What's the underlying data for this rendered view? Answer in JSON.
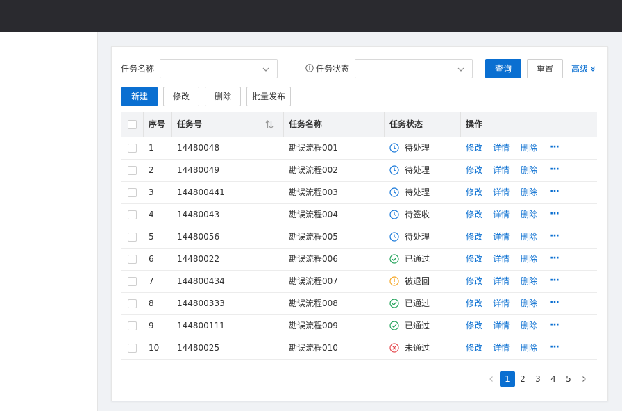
{
  "filters": {
    "task_name_label": "任务名称",
    "task_status_label": "任务状态",
    "task_name_value": "",
    "task_status_value": "",
    "query_label": "查询",
    "reset_label": "重置",
    "advanced_label": "高级"
  },
  "toolbar": {
    "new_label": "新建",
    "edit_label": "修改",
    "delete_label": "删除",
    "batch_publish_label": "批量发布"
  },
  "table": {
    "headers": {
      "index": "序号",
      "task_no": "任务号",
      "task_name": "任务名称",
      "status": "任务状态",
      "actions": "操作"
    },
    "action_labels": {
      "edit": "修改",
      "detail": "详情",
      "delete": "删除",
      "more": "···"
    },
    "rows": [
      {
        "index": "1",
        "task_no": "14480048",
        "task_name": "勘误流程001",
        "status": "待处理",
        "status_type": "pending"
      },
      {
        "index": "2",
        "task_no": "14480049",
        "task_name": "勘误流程002",
        "status": "待处理",
        "status_type": "pending"
      },
      {
        "index": "3",
        "task_no": "144800441",
        "task_name": "勘误流程003",
        "status": "待处理",
        "status_type": "pending"
      },
      {
        "index": "4",
        "task_no": "14480043",
        "task_name": "勘误流程004",
        "status": "待签收",
        "status_type": "pending"
      },
      {
        "index": "5",
        "task_no": "14480056",
        "task_name": "勘误流程005",
        "status": "待处理",
        "status_type": "pending"
      },
      {
        "index": "6",
        "task_no": "14480022",
        "task_name": "勘误流程006",
        "status": "已通过",
        "status_type": "passed"
      },
      {
        "index": "7",
        "task_no": "144800434",
        "task_name": "勘误流程007",
        "status": "被退回",
        "status_type": "returned"
      },
      {
        "index": "8",
        "task_no": "144800333",
        "task_name": "勘误流程008",
        "status": "已通过",
        "status_type": "passed"
      },
      {
        "index": "9",
        "task_no": "144800111",
        "task_name": "勘误流程009",
        "status": "已通过",
        "status_type": "passed"
      },
      {
        "index": "10",
        "task_no": "14480025",
        "task_name": "勘误流程010",
        "status": "未通过",
        "status_type": "failed"
      }
    ]
  },
  "pagination": {
    "pages": [
      "1",
      "2",
      "3",
      "4",
      "5"
    ],
    "current": "1"
  },
  "colors": {
    "primary": "#0a6fd1",
    "pending": "#1677d9",
    "passed": "#22a35a",
    "returned": "#f5a623",
    "failed": "#e5484d",
    "topbar": "#2a2a2f"
  }
}
